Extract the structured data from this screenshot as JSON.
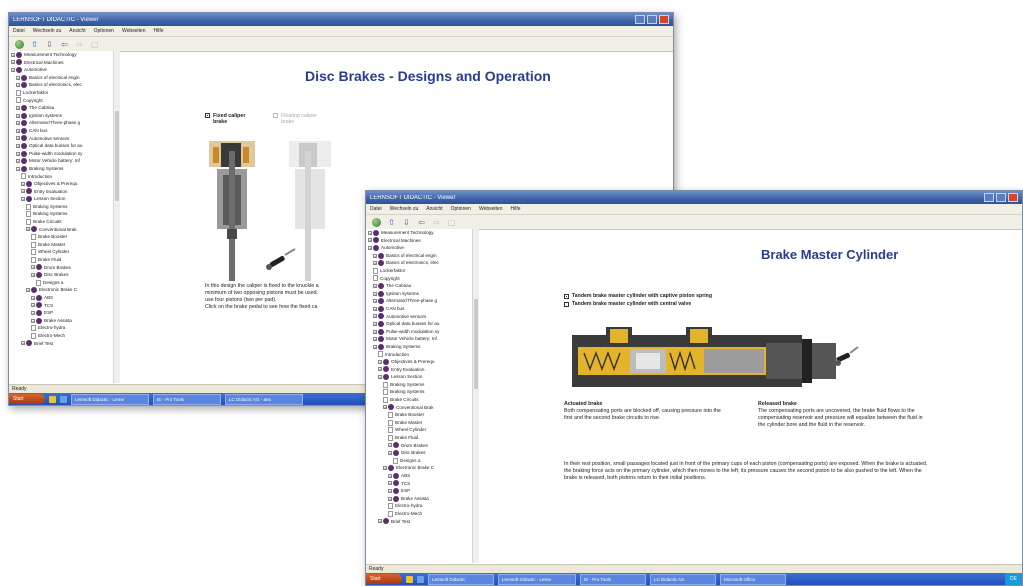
{
  "window1": {
    "title": "LERNSOFT DIDACTIC - Viewer",
    "menu": [
      "Datei",
      "Wechseln zu",
      "Ansicht",
      "Optionen",
      "Webseiten",
      "Hilfe"
    ],
    "heading": "Disc Brakes - Designs and Operation",
    "options": [
      {
        "label": "Fixed caliper brake",
        "selected": true
      },
      {
        "label": "Floating caliper brake",
        "selected": false
      }
    ],
    "description": [
      "In this design the caliper is fixed to the knuckle a",
      "minimum of two opposing pistons must be used. ",
      "use four pistons (two per pad).",
      "Click on the brake pedal to see how the fixed ca"
    ],
    "tree": [
      {
        "label": "Measurement Technology",
        "level": 0,
        "kind": "node"
      },
      {
        "label": "Electrical Machines",
        "level": 0,
        "kind": "node"
      },
      {
        "label": "Automotive",
        "level": 0,
        "kind": "node"
      },
      {
        "label": "Basics of electrical engin",
        "level": 1,
        "kind": "node"
      },
      {
        "label": "Basics of electronics, elec",
        "level": 1,
        "kind": "node"
      },
      {
        "label": "Lockerfaktor",
        "level": 1,
        "kind": "page"
      },
      {
        "label": "Copyright",
        "level": 1,
        "kind": "page"
      },
      {
        "label": "The Cabriau",
        "level": 1,
        "kind": "node"
      },
      {
        "label": "Ignition systems",
        "level": 1,
        "kind": "node"
      },
      {
        "label": "Alternator/Three-phase g",
        "level": 1,
        "kind": "node"
      },
      {
        "label": "CAN bus",
        "level": 1,
        "kind": "node"
      },
      {
        "label": "Automotive sensors",
        "level": 1,
        "kind": "node"
      },
      {
        "label": "Optical data busses for au",
        "level": 1,
        "kind": "node"
      },
      {
        "label": "Pulse-width modulation sy",
        "level": 1,
        "kind": "node"
      },
      {
        "label": "Motor Vehicle battery: Inf",
        "level": 1,
        "kind": "node"
      },
      {
        "label": "Braking Systems",
        "level": 1,
        "kind": "node"
      },
      {
        "label": "Introduction",
        "level": 2,
        "kind": "page"
      },
      {
        "label": "Objectives & Prerequ",
        "level": 2,
        "kind": "node"
      },
      {
        "label": "Entry Evaluation",
        "level": 2,
        "kind": "node"
      },
      {
        "label": "Lesson Section",
        "level": 2,
        "kind": "node"
      },
      {
        "label": "Braking Systems",
        "level": 3,
        "kind": "page"
      },
      {
        "label": "Braking Systems",
        "level": 3,
        "kind": "page"
      },
      {
        "label": "Brake Circuits",
        "level": 3,
        "kind": "page"
      },
      {
        "label": "Conventional Brak",
        "level": 3,
        "kind": "node"
      },
      {
        "label": "Brake Booster",
        "level": 4,
        "kind": "page"
      },
      {
        "label": "Brake Master",
        "level": 4,
        "kind": "page"
      },
      {
        "label": "Wheel Cylinder",
        "level": 4,
        "kind": "page"
      },
      {
        "label": "Brake Fluid",
        "level": 4,
        "kind": "page"
      },
      {
        "label": "Drum Brakes",
        "level": 4,
        "kind": "node"
      },
      {
        "label": "Disc Brakes",
        "level": 4,
        "kind": "node"
      },
      {
        "label": "Designs a",
        "level": 5,
        "kind": "page"
      },
      {
        "label": "Electronic Brake C",
        "level": 3,
        "kind": "node"
      },
      {
        "label": "ABS",
        "level": 4,
        "kind": "node"
      },
      {
        "label": "TCS",
        "level": 4,
        "kind": "node"
      },
      {
        "label": "ESP",
        "level": 4,
        "kind": "node"
      },
      {
        "label": "Brake Assista",
        "level": 4,
        "kind": "node"
      },
      {
        "label": "Electro-hydra",
        "level": 4,
        "kind": "page"
      },
      {
        "label": "Electro-Mech",
        "level": 4,
        "kind": "page"
      },
      {
        "label": "Brief Test",
        "level": 2,
        "kind": "node"
      }
    ],
    "status": "Ready",
    "taskbar": {
      "start": "Start",
      "tasks": [
        "Lernsoft Didactic - Lerne",
        "IE - Pro Tools",
        "LC Didactic AG - ans"
      ]
    }
  },
  "window2": {
    "title": "LERNSOFT DIDACTIC - Viewer",
    "menu": [
      "Datei",
      "Wechseln zu",
      "Ansicht",
      "Optionen",
      "Webseiten",
      "Hilfe"
    ],
    "heading": "Brake Master Cylinder",
    "options": [
      {
        "label": "Tandem brake master cylinder with captive piston spring",
        "selected": true
      },
      {
        "label": "Tandem brake master cylinder with central valve",
        "selected": false
      }
    ],
    "actuated": {
      "title": "Actuated brake",
      "text": "Both compensating ports are blocked off, causing pressure into the first and the second brake circuits to rise."
    },
    "released": {
      "title": "Released brake",
      "text": "The compensating ports are uncovered, the brake fluid flows to the compensating reservoir and pressure will equalize between the fluid in the cylinder bore and the fluid in the reservoir."
    },
    "paragraph": "In their rest position, small passages located just in front of the primary cups of each piston (compensating ports) are exposed. When the brake is actuated, the braking force acts on the primary cylinder, which then moves to the left; its pressure causes the second piston to be also pushed to the left. When the brake is released, both pistons return to their initial positions.",
    "tree": [
      {
        "label": "Measurement Technology",
        "level": 0,
        "kind": "node"
      },
      {
        "label": "Electrical Machines",
        "level": 0,
        "kind": "node"
      },
      {
        "label": "Automotive",
        "level": 0,
        "kind": "node"
      },
      {
        "label": "Basics of electrical engin",
        "level": 1,
        "kind": "node"
      },
      {
        "label": "Basics of electronics, elec",
        "level": 1,
        "kind": "node"
      },
      {
        "label": "Lockerfaktor",
        "level": 1,
        "kind": "page"
      },
      {
        "label": "Copyright",
        "level": 1,
        "kind": "page"
      },
      {
        "label": "The Cabriau",
        "level": 1,
        "kind": "node"
      },
      {
        "label": "Ignition systems",
        "level": 1,
        "kind": "node"
      },
      {
        "label": "Alternator/Three-phase g",
        "level": 1,
        "kind": "node"
      },
      {
        "label": "CAN bus",
        "level": 1,
        "kind": "node"
      },
      {
        "label": "Automotive sensors",
        "level": 1,
        "kind": "node"
      },
      {
        "label": "Optical data busses for au",
        "level": 1,
        "kind": "node"
      },
      {
        "label": "Pulse-width modulation sy",
        "level": 1,
        "kind": "node"
      },
      {
        "label": "Motor Vehicle battery: Inf",
        "level": 1,
        "kind": "node"
      },
      {
        "label": "Braking Systems",
        "level": 1,
        "kind": "node"
      },
      {
        "label": "Introduction",
        "level": 2,
        "kind": "page"
      },
      {
        "label": "Objectives & Prerequ",
        "level": 2,
        "kind": "node"
      },
      {
        "label": "Entry Evaluation",
        "level": 2,
        "kind": "node"
      },
      {
        "label": "Lesson Section",
        "level": 2,
        "kind": "node"
      },
      {
        "label": "Braking Systems",
        "level": 3,
        "kind": "page"
      },
      {
        "label": "Braking Systems",
        "level": 3,
        "kind": "page"
      },
      {
        "label": "Brake Circuits",
        "level": 3,
        "kind": "page"
      },
      {
        "label": "Conventional Brak",
        "level": 3,
        "kind": "node"
      },
      {
        "label": "Brake Booster",
        "level": 4,
        "kind": "page"
      },
      {
        "label": "Brake Master",
        "level": 4,
        "kind": "page"
      },
      {
        "label": "Wheel Cylinder",
        "level": 4,
        "kind": "page"
      },
      {
        "label": "Brake Fluid",
        "level": 4,
        "kind": "page"
      },
      {
        "label": "Drum Brakes",
        "level": 4,
        "kind": "node"
      },
      {
        "label": "Disc Brakes",
        "level": 4,
        "kind": "node"
      },
      {
        "label": "Designs a",
        "level": 5,
        "kind": "page"
      },
      {
        "label": "Electronic Brake C",
        "level": 3,
        "kind": "node"
      },
      {
        "label": "ABS",
        "level": 4,
        "kind": "node"
      },
      {
        "label": "TCS",
        "level": 4,
        "kind": "node"
      },
      {
        "label": "ESP",
        "level": 4,
        "kind": "node"
      },
      {
        "label": "Brake Assista",
        "level": 4,
        "kind": "node"
      },
      {
        "label": "Electro-hydra",
        "level": 4,
        "kind": "page"
      },
      {
        "label": "Electro-Mech",
        "level": 4,
        "kind": "page"
      },
      {
        "label": "Brief Test",
        "level": 2,
        "kind": "node"
      }
    ],
    "status": "Ready",
    "taskbar": {
      "start": "Start",
      "tasks": [
        "Lernsoft Didactic",
        "Lernsoft Didactic - Lerne",
        "IE - Pro Tools",
        "LC Didactic AG",
        "Microsoft Office"
      ],
      "tray": "DE"
    }
  },
  "colors": {
    "heading": "#2b3c8f",
    "titlebar": "#3f63a8",
    "taskbar": "#2350b8",
    "tree_node": "#5a2f6d",
    "caliper_orange": "#c98a2a",
    "cylinder_yellow": "#e3b32c"
  }
}
